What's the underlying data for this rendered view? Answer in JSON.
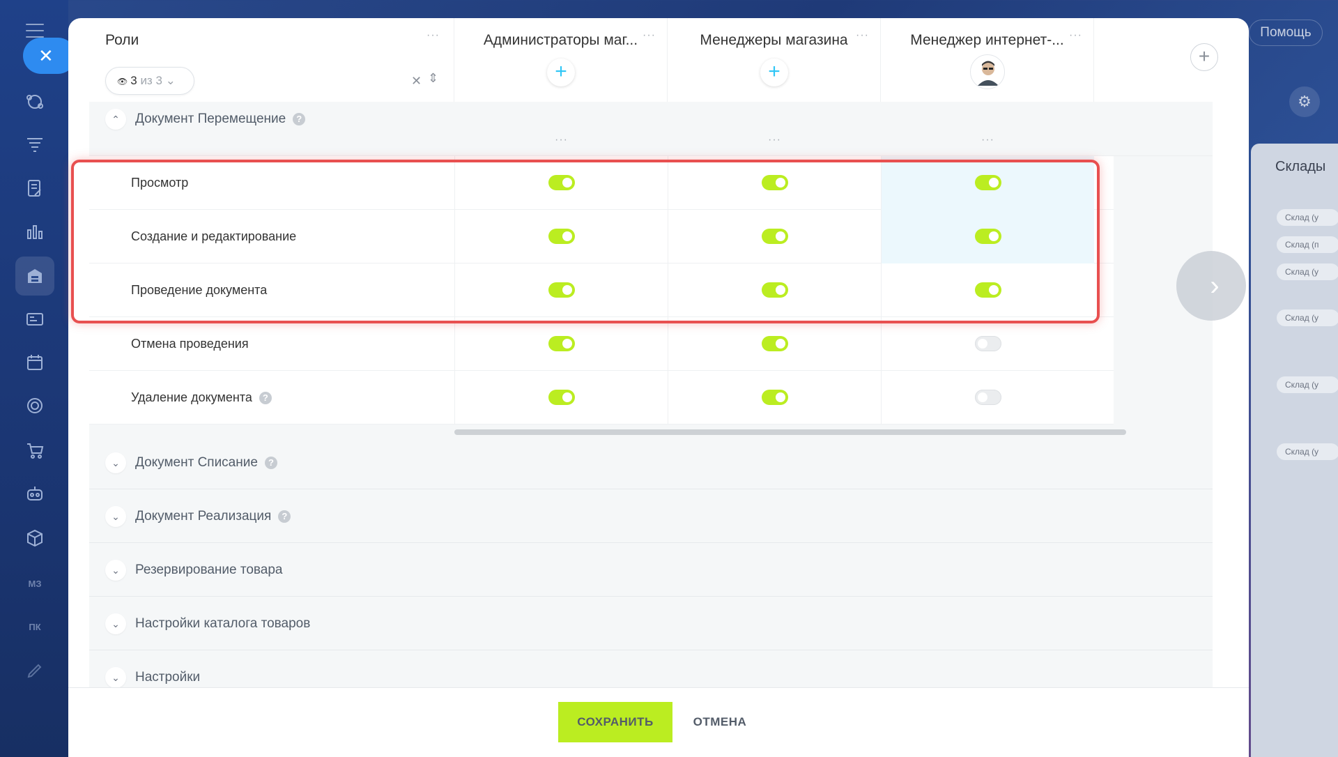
{
  "help": {
    "label": "Помощь"
  },
  "background_panel": {
    "title": "Склады",
    "tags": [
      "Склад (у",
      "Склад (п",
      "Склад (у",
      "Склад (у",
      "Склад (у",
      "Склад (у"
    ]
  },
  "sidebar": {
    "text_items": [
      "МЗ",
      "ПК"
    ]
  },
  "roles_header": {
    "title": "Роли",
    "filter_count": "3",
    "filter_of": "из 3"
  },
  "columns": [
    {
      "name": "Администраторы маг...",
      "action": "+"
    },
    {
      "name": "Менеджеры магазина",
      "action": "+"
    },
    {
      "name": "Менеджер интернет-...",
      "action": "avatar"
    }
  ],
  "open_section": {
    "title": "Документ Перемещение"
  },
  "permission_rows": [
    {
      "label": "Просмотр",
      "values": [
        true,
        true,
        true
      ]
    },
    {
      "label": "Создание и редактирование",
      "values": [
        true,
        true,
        true
      ]
    },
    {
      "label": "Проведение документа",
      "values": [
        true,
        true,
        true
      ]
    },
    {
      "label": "Отмена проведения",
      "values": [
        true,
        true,
        false
      ]
    },
    {
      "label": "Удаление документа",
      "values": [
        true,
        true,
        false
      ]
    }
  ],
  "collapsed_sections": [
    {
      "title": "Документ Списание",
      "help": true
    },
    {
      "title": "Документ Реализация",
      "help": true
    },
    {
      "title": "Резервирование товара",
      "help": false
    },
    {
      "title": "Настройки каталога товаров",
      "help": false
    },
    {
      "title": "Настройки",
      "help": false
    }
  ],
  "footer": {
    "save_label": "СОХРАНИТЬ",
    "cancel_label": "ОТМЕНА"
  },
  "colors": {
    "accent_green": "#bbed21",
    "plus_blue": "#2fc6f6",
    "highlight_red": "#e85050"
  }
}
